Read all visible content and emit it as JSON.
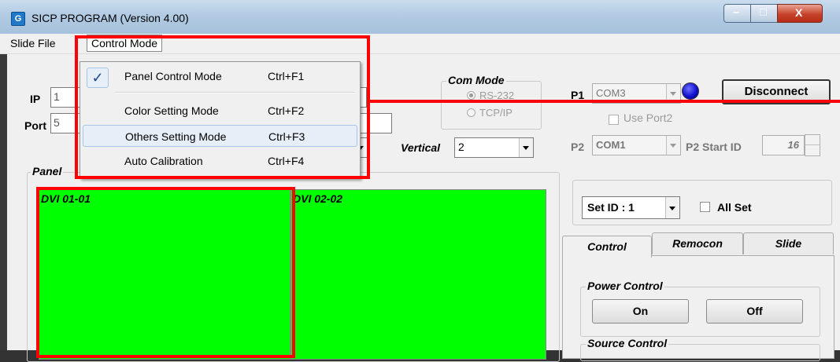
{
  "window": {
    "title": "SICP PROGRAM (Version 4.00)",
    "icon_letter": "G",
    "minimize_symbol": "–",
    "maximize_symbol": "□",
    "close_symbol": "X"
  },
  "menubar": {
    "slide_file": "Slide File",
    "control_mode": "Control Mode"
  },
  "control_menu": {
    "check_glyph": "✓",
    "items": [
      {
        "label": "Panel Control Mode",
        "shortcut": "Ctrl+F1",
        "checked": true
      },
      {
        "label": "Color Setting Mode",
        "shortcut": "Ctrl+F2"
      },
      {
        "label": "Others Setting Mode",
        "shortcut": "Ctrl+F3",
        "highlighted": true
      },
      {
        "label": "Auto Calibration",
        "shortcut": "Ctrl+F4"
      }
    ]
  },
  "connection": {
    "ip_label": "IP",
    "ip_value": "1",
    "port_label": "Port",
    "port_value": "5"
  },
  "com_mode": {
    "label": "Com Mode",
    "rs232": "RS-232",
    "tcpip": "TCP/IP",
    "selected": "RS-232"
  },
  "ports": {
    "p1_label": "P1",
    "p1_value": "COM3",
    "disconnect": "Disconnect",
    "use_port2": "Use Port2",
    "p2_label": "P2",
    "p2_value": "COM1",
    "p2_start_id_label": "P2 Start ID",
    "p2_start_id_value": "16"
  },
  "layout": {
    "vertical_label": "Vertical",
    "vertical_value": "2",
    "panel_label": "Panel"
  },
  "screens": [
    {
      "label": "DVI 01-01"
    },
    {
      "label": "DVI 02-02"
    }
  ],
  "set_id": {
    "value": "Set ID : 1",
    "all_set": "All Set"
  },
  "tabs": [
    "Control",
    "Remocon",
    "Slide"
  ],
  "power_control": {
    "label": "Power Control",
    "on": "On",
    "off": "Off"
  },
  "source_control": {
    "label": "Source Control"
  },
  "colors": {
    "screen_green": "#00ff00",
    "annotation_red": "#ff0000",
    "status_led": "#1010d0"
  }
}
